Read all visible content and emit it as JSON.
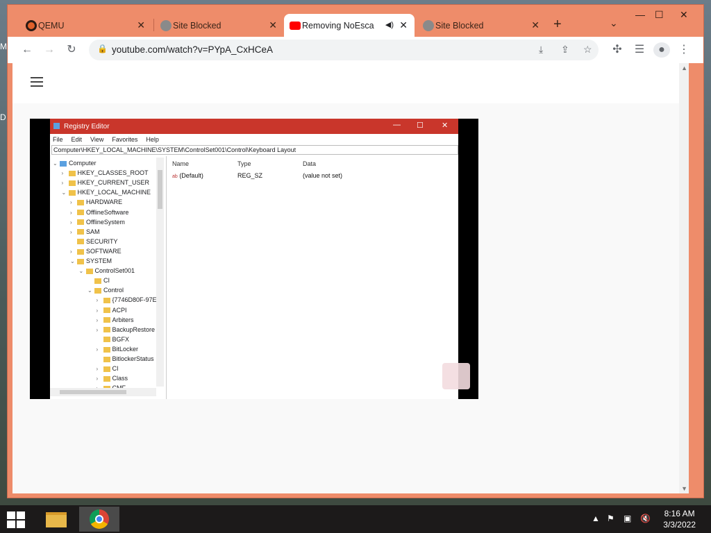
{
  "desktop": {
    "left_glyphs": [
      "M",
      "D"
    ]
  },
  "browser": {
    "tabs": [
      {
        "title": "QEMU",
        "icon": "qemu-icon",
        "active": false
      },
      {
        "title": "Site Blocked",
        "icon": "globe-icon",
        "active": false
      },
      {
        "title": "Removing NoEscap",
        "icon": "youtube-icon",
        "active": true,
        "audio": true
      },
      {
        "title": "Site Blocked",
        "icon": "globe-icon",
        "active": false
      }
    ],
    "new_tab_glyph": "+",
    "tab_list_glyph": "⌄",
    "window_controls": {
      "minimize": "—",
      "maximize": "☐",
      "close": "✕"
    },
    "address": "youtube.com/watch?v=PYpA_CxHCeA",
    "accent": "#ee8c6a"
  },
  "video": {
    "app_title": "Registry Editor",
    "menu": [
      "File",
      "Edit",
      "View",
      "Favorites",
      "Help"
    ],
    "address_path": "Computer\\HKEY_LOCAL_MACHINE\\SYSTEM\\ControlSet001\\Control\\Keyboard Layout",
    "tree": [
      {
        "label": "Computer",
        "depth": 0,
        "arrow": "v",
        "icon": "computer"
      },
      {
        "label": "HKEY_CLASSES_ROOT",
        "depth": 1,
        "arrow": ">"
      },
      {
        "label": "HKEY_CURRENT_USER",
        "depth": 1,
        "arrow": ">"
      },
      {
        "label": "HKEY_LOCAL_MACHINE",
        "depth": 1,
        "arrow": "v"
      },
      {
        "label": "HARDWARE",
        "depth": 2,
        "arrow": ">"
      },
      {
        "label": "OfflineSoftware",
        "depth": 2,
        "arrow": ">"
      },
      {
        "label": "OfflineSystem",
        "depth": 2,
        "arrow": ">"
      },
      {
        "label": "SAM",
        "depth": 2,
        "arrow": ">"
      },
      {
        "label": "SECURITY",
        "depth": 2,
        "arrow": ""
      },
      {
        "label": "SOFTWARE",
        "depth": 2,
        "arrow": ">"
      },
      {
        "label": "SYSTEM",
        "depth": 2,
        "arrow": "v"
      },
      {
        "label": "ControlSet001",
        "depth": 3,
        "arrow": "v"
      },
      {
        "label": "CI",
        "depth": 4,
        "arrow": ""
      },
      {
        "label": "Control",
        "depth": 4,
        "arrow": "v"
      },
      {
        "label": "{7746D80F-97E",
        "depth": 5,
        "arrow": ">"
      },
      {
        "label": "ACPI",
        "depth": 5,
        "arrow": ">"
      },
      {
        "label": "Arbiters",
        "depth": 5,
        "arrow": ">"
      },
      {
        "label": "BackupRestore",
        "depth": 5,
        "arrow": ">"
      },
      {
        "label": "BGFX",
        "depth": 5,
        "arrow": ""
      },
      {
        "label": "BitLocker",
        "depth": 5,
        "arrow": ">"
      },
      {
        "label": "BitlockerStatus",
        "depth": 5,
        "arrow": ""
      },
      {
        "label": "CI",
        "depth": 5,
        "arrow": ">"
      },
      {
        "label": "Class",
        "depth": 5,
        "arrow": ">"
      },
      {
        "label": "CMF",
        "depth": 5,
        "arrow": ">"
      }
    ],
    "columns": [
      "Name",
      "Type",
      "Data"
    ],
    "row": {
      "name": "(Default)",
      "type": "REG_SZ",
      "data": "(value not set)"
    }
  },
  "taskbar": {
    "apps": [
      "file-explorer-icon",
      "chrome-icon"
    ],
    "tray_icons": [
      "chevron-up-icon",
      "flag-icon",
      "network-icon",
      "volume-muted-icon"
    ],
    "time": "8:16 AM",
    "date": "3/3/2022"
  }
}
